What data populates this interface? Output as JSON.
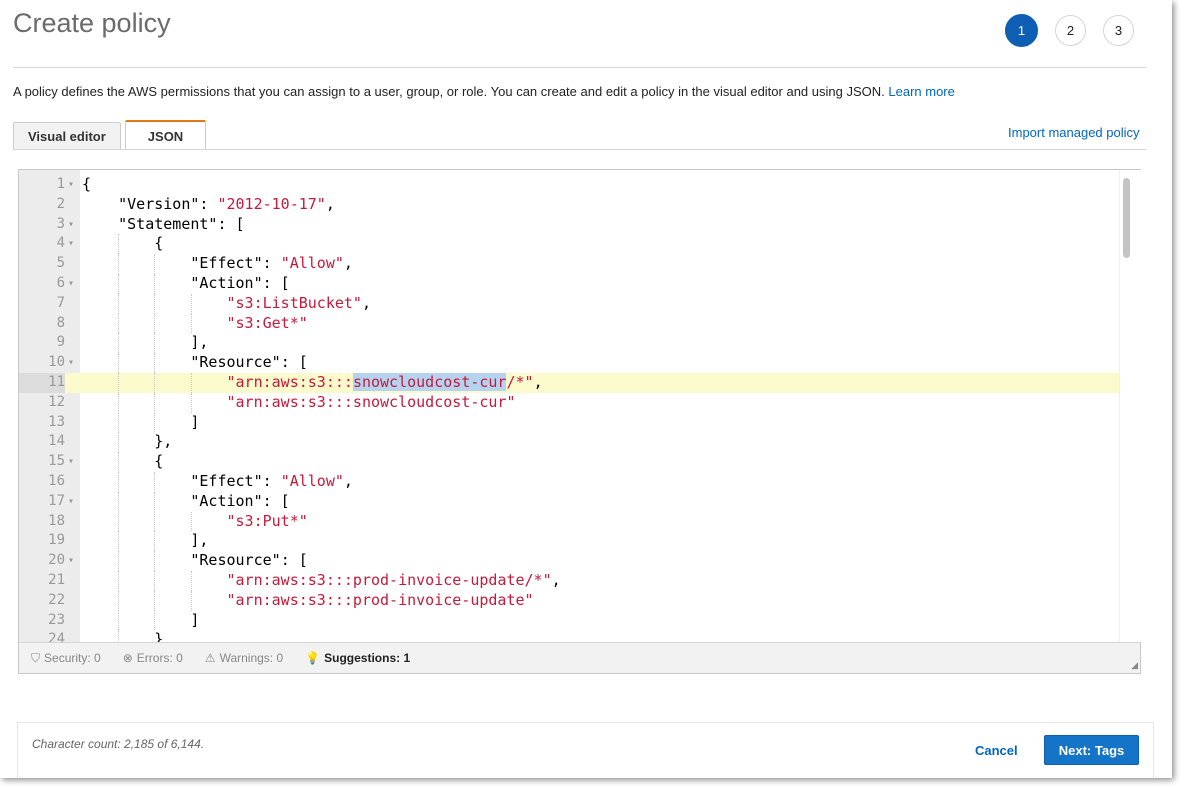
{
  "page": {
    "title": "Create policy",
    "steps": [
      "1",
      "2",
      "3"
    ],
    "active_step": "1",
    "description": "A policy defines the AWS permissions that you can assign to a user, group, or role. You can create and edit a policy in the visual editor and using JSON.",
    "learn_more": "Learn more"
  },
  "tabs": [
    {
      "label": "Visual editor",
      "active": false
    },
    {
      "label": "JSON",
      "active": true
    }
  ],
  "import_link": "Import managed policy",
  "editor": {
    "active_line": 11,
    "highlighted_text": "snowcloudcost-cur",
    "lines": [
      {
        "n": "1",
        "fold": true,
        "text": "{"
      },
      {
        "n": "2",
        "fold": false,
        "text": "    \"Version\": \"2012-10-17\","
      },
      {
        "n": "3",
        "fold": true,
        "text": "    \"Statement\": ["
      },
      {
        "n": "4",
        "fold": true,
        "text": "        {"
      },
      {
        "n": "5",
        "fold": false,
        "text": "            \"Effect\": \"Allow\","
      },
      {
        "n": "6",
        "fold": true,
        "text": "            \"Action\": ["
      },
      {
        "n": "7",
        "fold": false,
        "text": "                \"s3:ListBucket\","
      },
      {
        "n": "8",
        "fold": false,
        "text": "                \"s3:Get*\""
      },
      {
        "n": "9",
        "fold": false,
        "text": "            ],"
      },
      {
        "n": "10",
        "fold": true,
        "text": "            \"Resource\": ["
      },
      {
        "n": "11",
        "fold": false,
        "text": "                \"arn:aws:s3:::snowcloudcost-cur/*\","
      },
      {
        "n": "12",
        "fold": false,
        "text": "                \"arn:aws:s3:::snowcloudcost-cur\""
      },
      {
        "n": "13",
        "fold": false,
        "text": "            ]"
      },
      {
        "n": "14",
        "fold": false,
        "text": "        },"
      },
      {
        "n": "15",
        "fold": true,
        "text": "        {"
      },
      {
        "n": "16",
        "fold": false,
        "text": "            \"Effect\": \"Allow\","
      },
      {
        "n": "17",
        "fold": true,
        "text": "            \"Action\": ["
      },
      {
        "n": "18",
        "fold": false,
        "text": "                \"s3:Put*\""
      },
      {
        "n": "19",
        "fold": false,
        "text": "            ],"
      },
      {
        "n": "20",
        "fold": true,
        "text": "            \"Resource\": ["
      },
      {
        "n": "21",
        "fold": false,
        "text": "                \"arn:aws:s3:::prod-invoice-update/*\","
      },
      {
        "n": "22",
        "fold": false,
        "text": "                \"arn:aws:s3:::prod-invoice-update\""
      },
      {
        "n": "23",
        "fold": false,
        "text": "            ]"
      },
      {
        "n": "24",
        "fold": false,
        "text": "        }"
      }
    ]
  },
  "status": {
    "security": "Security: 0",
    "errors": "Errors: 0",
    "warnings": "Warnings: 0",
    "suggestions": "Suggestions: 1"
  },
  "footer": {
    "char_count": "Character count: 2,185 of 6,144.",
    "cancel": "Cancel",
    "next": "Next: Tags"
  }
}
